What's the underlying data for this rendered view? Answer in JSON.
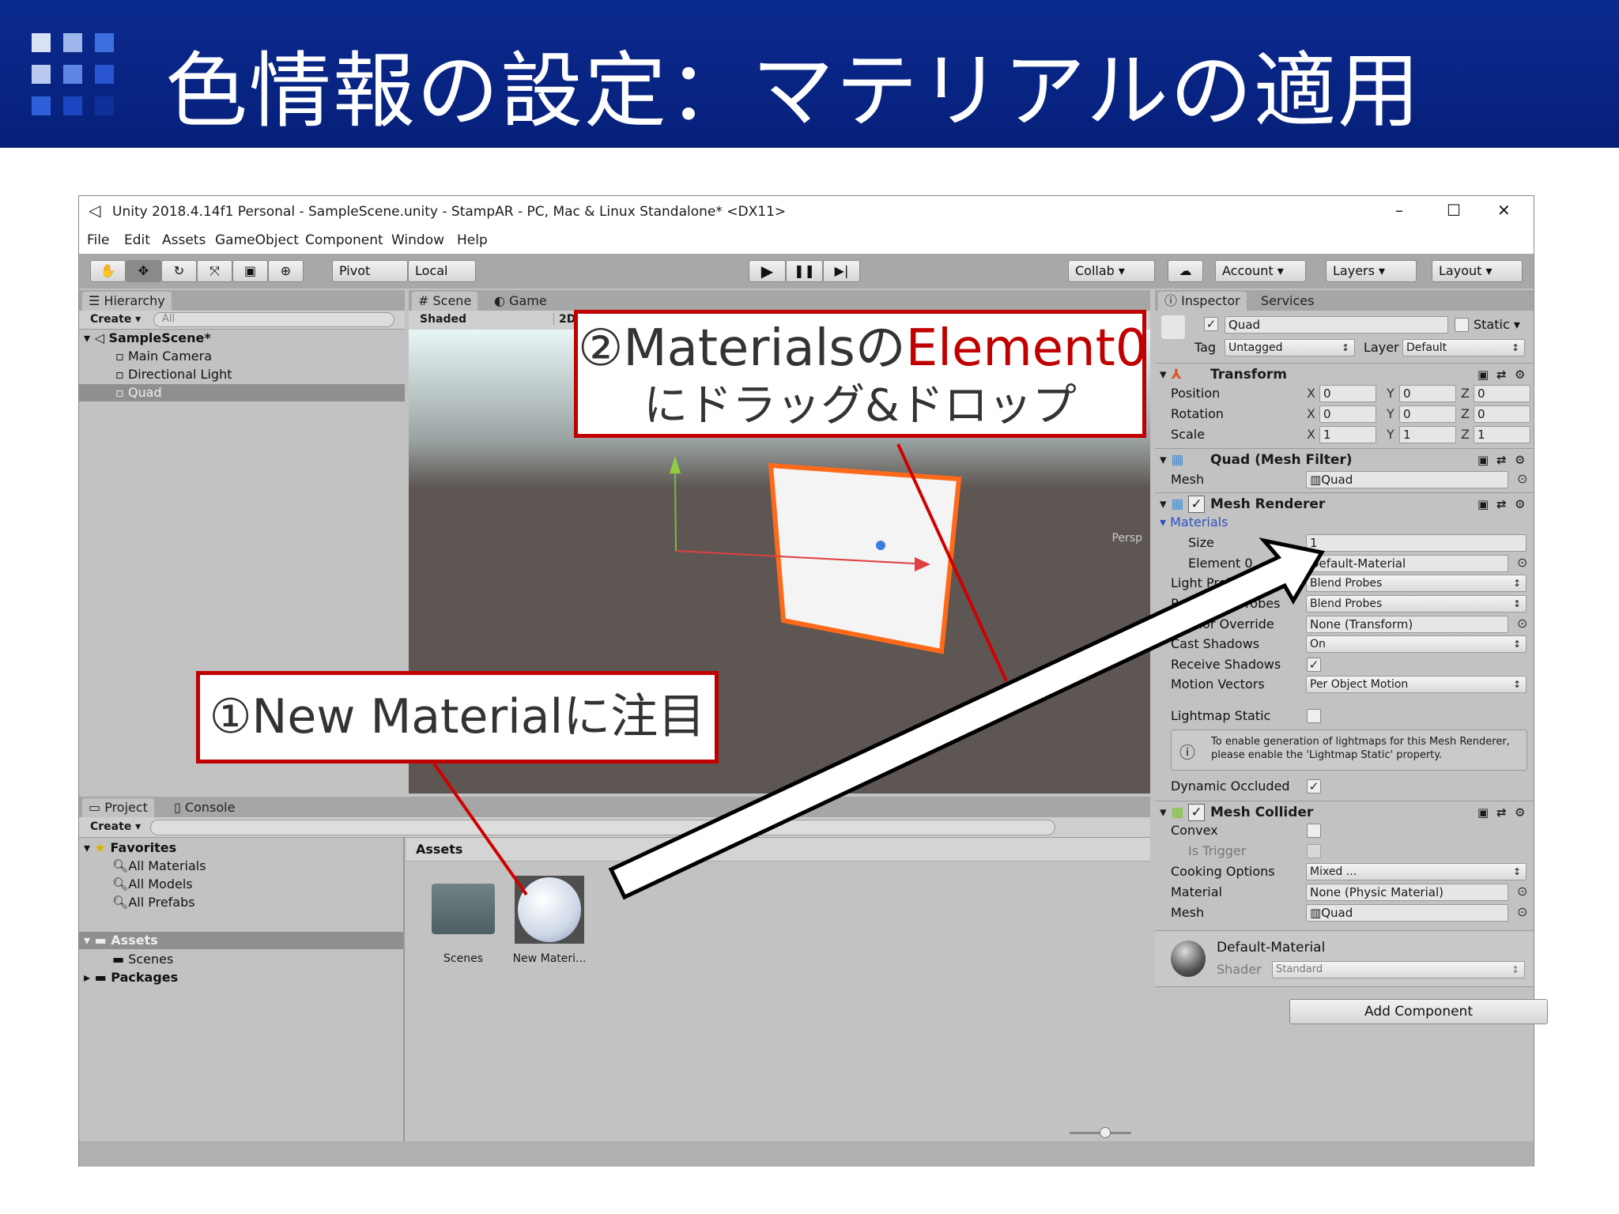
{
  "slide": {
    "title": "色情報の設定：マテリアルの適用",
    "accent": "#0b2a8f"
  },
  "window": {
    "title": "Unity 2018.4.14f1 Personal - SampleScene.unity - StampAR - PC, Mac & Linux Standalone* <DX11>",
    "min": "–",
    "max": "☐",
    "close": "✕"
  },
  "menu": [
    "File",
    "Edit",
    "Assets",
    "GameObject",
    "Component",
    "Window",
    "Help"
  ],
  "toolbar": {
    "pivot": "Pivot",
    "local": "Local",
    "collab": "Collab ▾",
    "account": "Account ▾",
    "layers": "Layers ▾",
    "layout": "Layout ▾"
  },
  "hierarchy": {
    "tab": "Hierarchy",
    "create": "Create ▾",
    "search": "All",
    "scene": "SampleScene*",
    "items": [
      "Main Camera",
      "Directional Light",
      "Quad"
    ]
  },
  "scene": {
    "tab_scene": "Scene",
    "tab_game": "Game",
    "shading": "Shaded",
    "mode2d": "2D",
    "persp": "Persp"
  },
  "project": {
    "tab_project": "Project",
    "tab_console": "Console",
    "create": "Create ▾",
    "favorites": "Favorites",
    "fav_items": [
      "All Materials",
      "All Models",
      "All Prefabs"
    ],
    "assets": "Assets",
    "scenes": "Scenes",
    "packages": "Packages",
    "breadcrumb": "Assets",
    "grid_items": [
      "Scenes",
      "New Materi..."
    ]
  },
  "inspector": {
    "tab": "Inspector",
    "tab_services": "Services",
    "name": "Quad",
    "static": "Static",
    "tag_label": "Tag",
    "tag": "Untagged",
    "layer_label": "Layer",
    "layer": "Default",
    "transform": {
      "title": "Transform",
      "rows": [
        {
          "label": "Position",
          "x": "0",
          "y": "0",
          "z": "0"
        },
        {
          "label": "Rotation",
          "x": "0",
          "y": "0",
          "z": "0"
        },
        {
          "label": "Scale",
          "x": "1",
          "y": "1",
          "z": "1"
        }
      ]
    },
    "mesh_filter": {
      "title": "Quad (Mesh Filter)",
      "mesh_label": "Mesh",
      "mesh": "Quad"
    },
    "mesh_renderer": {
      "title": "Mesh Renderer",
      "materials": "Materials",
      "size_label": "Size",
      "size": "1",
      "element0_label": "Element 0",
      "element0": "Default-Material",
      "light_probes_label": "Light Probes",
      "light_probes": "Blend Probes",
      "reflection_label": "Reflection Probes",
      "reflection": "Blend Probes",
      "anchor_label": "Anchor Override",
      "anchor": "None (Transform)",
      "cast_label": "Cast Shadows",
      "cast": "On",
      "receive_label": "Receive Shadows",
      "motion_label": "Motion Vectors",
      "motion": "Per Object Motion",
      "lightmap_label": "Lightmap Static",
      "help": "To enable generation of lightmaps for this Mesh Renderer, please enable the 'Lightmap Static' property.",
      "occluded_label": "Dynamic Occluded"
    },
    "mesh_collider": {
      "title": "Mesh Collider",
      "convex": "Convex",
      "trigger": "Is Trigger",
      "cooking_label": "Cooking Options",
      "cooking": "Mixed ...",
      "material_label": "Material",
      "material": "None (Physic Material)",
      "mesh_label": "Mesh",
      "mesh": "Quad"
    },
    "material": {
      "name": "Default-Material",
      "shader_label": "Shader",
      "shader": "Standard"
    },
    "add_component": "Add Component"
  },
  "callouts": {
    "c2_prefix": "②Materialsの",
    "c2_highlight": "Element0",
    "c2_line2": "にドラッグ&ドロップ",
    "c1": "①New Materialに注目",
    "highlight_color": "#c00000"
  }
}
